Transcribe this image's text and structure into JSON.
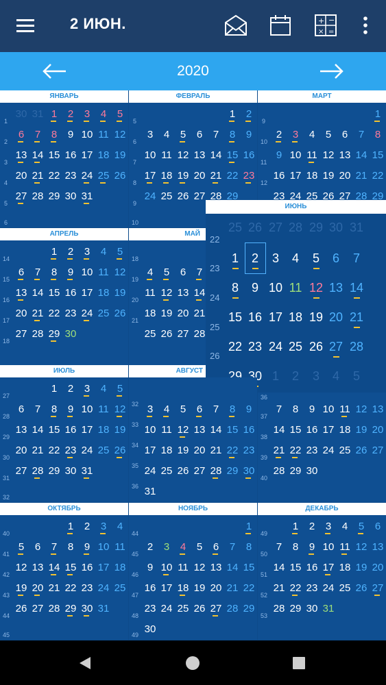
{
  "header": {
    "title": "2 ИЮН.",
    "menu_icon": "hamburger-menu-icon",
    "actions": [
      "mail-icon",
      "calendar-icon",
      "calculator-icon",
      "more-vertical-icon"
    ]
  },
  "yearbar": {
    "year": "2020",
    "prev_icon": "arrow-left-icon",
    "next_icon": "arrow-right-icon"
  },
  "months": [
    {
      "name": "ЯНВАРЬ"
    },
    {
      "name": "ФЕВРАЛЬ"
    },
    {
      "name": "МАРТ"
    },
    {
      "name": "АПРЕЛЬ"
    },
    {
      "name": "МАЙ"
    },
    {
      "name": "ИЮНЬ"
    },
    {
      "name": "ИЮЛЬ"
    },
    {
      "name": "АВГУСТ"
    },
    {
      "name": "ОКТЯБРЬ"
    },
    {
      "name": "НОЯБРЬ"
    },
    {
      "name": "ДЕКАБРЬ"
    }
  ],
  "colors": {
    "topbar": "#1e3f69",
    "yearbar": "#2ea6ef",
    "background": "#0d4a8a",
    "weekend": "#4fb3ff",
    "holiday": "#ff7a9a",
    "mark": "#f2c230"
  },
  "navbar": {
    "icons": [
      "back-triangle-icon",
      "home-circle-icon",
      "recents-square-icon"
    ]
  }
}
